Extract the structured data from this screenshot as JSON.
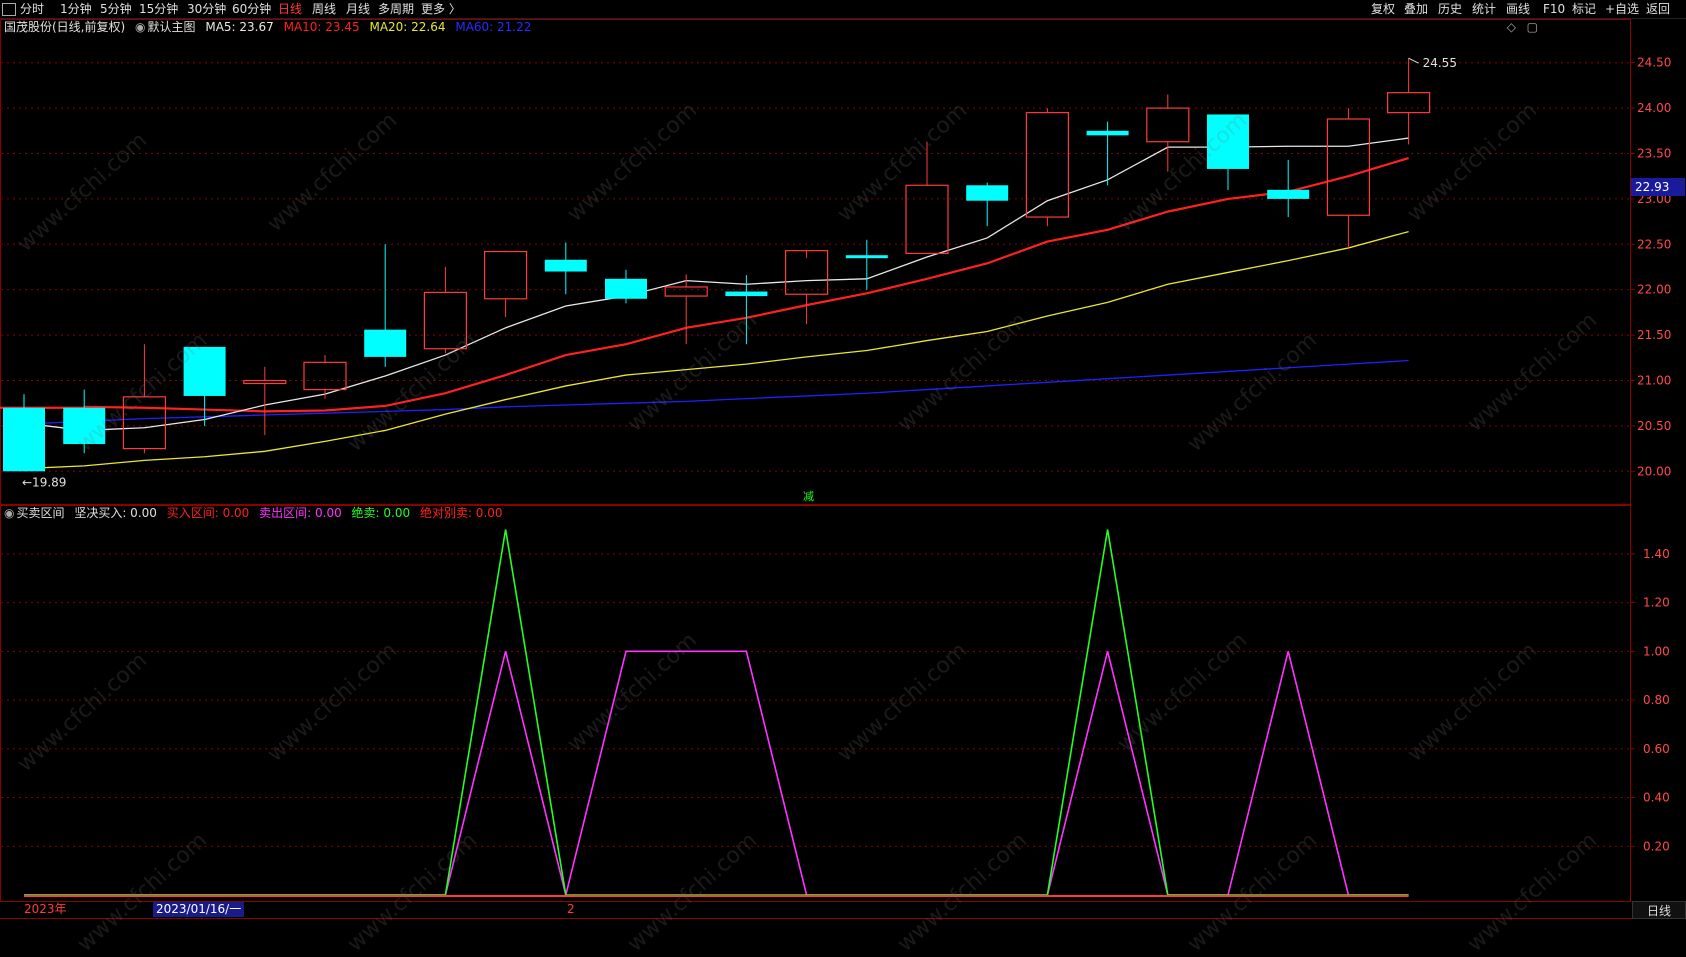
{
  "toolbar": {
    "left_items": [
      "分时",
      "1分钟",
      "5分钟",
      "15分钟",
      "30分钟",
      "60分钟",
      "日线",
      "周线",
      "月线",
      "多周期",
      "更多 〉"
    ],
    "active_item": "日线",
    "right_items": [
      "复权",
      "叠加",
      "历史",
      "统计",
      "画线",
      "F10",
      "标记",
      "+自选",
      "返回"
    ]
  },
  "main_info": {
    "stock": "国茂股份(日线,前复权)",
    "template": "默认主图",
    "ma5": "MA5: 23.67",
    "ma10": "MA10: 23.45",
    "ma20": "MA20: 22.64",
    "ma60": "MA60: 21.22"
  },
  "sub_info": {
    "name": "买卖区间",
    "firm_buy": "坚决买入: 0.00",
    "buy_zone": "买入区间: 0.00",
    "sell_zone": "卖出区间: 0.00",
    "sell": "绝卖: 0.00",
    "must_sell": "绝对别卖: 0.00"
  },
  "price_axis": [
    "24.50",
    "24.00",
    "23.50",
    "23.00",
    "22.50",
    "22.00",
    "21.50",
    "21.00",
    "20.50",
    "20.00"
  ],
  "current_price": "22.93",
  "high_label": "24.55",
  "low_label": "←19.89",
  "sub_axis": [
    "1.40",
    "1.20",
    "1.00",
    "0.80",
    "0.60",
    "0.40",
    "0.20"
  ],
  "date_labels": {
    "year": "2023年",
    "cursor_date": "2023/01/16/一",
    "month": "2"
  },
  "period_button": "日线",
  "watermark": "www.cfchi.com",
  "colors": {
    "up": "#ff3b3b",
    "down": "#00ffff",
    "ma5": "#e8e8e8",
    "ma10": "#ff2020",
    "ma20": "#e8e830",
    "ma60": "#2020ff",
    "green": "#22ff22",
    "magenta": "#ff33ff",
    "grid": "#8b0000"
  },
  "chart_data": {
    "type": "candlestick",
    "candles": [
      {
        "o": 20.7,
        "h": 20.85,
        "l": 20.0,
        "c": 20.0
      },
      {
        "o": 20.7,
        "h": 20.9,
        "l": 20.2,
        "c": 20.3
      },
      {
        "o": 20.25,
        "h": 21.4,
        "l": 20.2,
        "c": 20.82
      },
      {
        "o": 21.37,
        "h": 21.37,
        "l": 20.5,
        "c": 20.83
      },
      {
        "o": 21.0,
        "h": 21.15,
        "l": 20.4,
        "c": 21.0
      },
      {
        "o": 20.9,
        "h": 21.28,
        "l": 20.8,
        "c": 21.2
      },
      {
        "o": 21.56,
        "h": 22.5,
        "l": 21.15,
        "c": 21.26
      },
      {
        "o": 21.35,
        "h": 22.25,
        "l": 21.3,
        "c": 21.97
      },
      {
        "o": 21.9,
        "h": 22.43,
        "l": 21.7,
        "c": 22.42
      },
      {
        "o": 22.33,
        "h": 22.52,
        "l": 21.95,
        "c": 22.2
      },
      {
        "o": 22.12,
        "h": 22.22,
        "l": 21.85,
        "c": 21.9
      },
      {
        "o": 21.93,
        "h": 22.17,
        "l": 21.4,
        "c": 22.03
      },
      {
        "o": 21.98,
        "h": 22.16,
        "l": 21.4,
        "c": 21.93
      },
      {
        "o": 21.95,
        "h": 22.35,
        "l": 21.62,
        "c": 22.43
      },
      {
        "o": 22.38,
        "h": 22.55,
        "l": 22.0,
        "c": 22.37
      },
      {
        "o": 22.4,
        "h": 23.63,
        "l": 22.4,
        "c": 23.15
      },
      {
        "o": 23.15,
        "h": 23.18,
        "l": 22.7,
        "c": 22.98
      },
      {
        "o": 22.8,
        "h": 24.0,
        "l": 22.7,
        "c": 23.95
      },
      {
        "o": 23.75,
        "h": 23.85,
        "l": 23.15,
        "c": 23.7
      },
      {
        "o": 23.63,
        "h": 24.15,
        "l": 23.3,
        "c": 24.0
      },
      {
        "o": 23.93,
        "h": 23.93,
        "l": 23.1,
        "c": 23.33
      },
      {
        "o": 23.1,
        "h": 23.43,
        "l": 22.8,
        "c": 23.0
      },
      {
        "o": 22.82,
        "h": 24.0,
        "l": 22.45,
        "c": 23.88
      },
      {
        "o": 23.95,
        "h": 24.55,
        "l": 23.6,
        "c": 24.17
      }
    ],
    "ma5": [
      20.53,
      20.45,
      20.48,
      20.57,
      20.73,
      20.85,
      21.05,
      21.28,
      21.58,
      21.82,
      21.93,
      22.1,
      22.06,
      22.1,
      22.12,
      22.36,
      22.57,
      22.98,
      23.21,
      23.57,
      23.57,
      23.58,
      23.58,
      23.67
    ],
    "ma10": [
      20.71,
      20.7,
      20.68,
      20.66,
      20.67,
      20.72,
      20.86,
      21.06,
      21.28,
      21.4,
      21.58,
      21.69,
      21.83,
      21.96,
      22.12,
      22.29,
      22.53,
      22.66,
      22.86,
      23.0,
      23.08,
      23.25,
      23.45
    ],
    "ma20": [
      20.03,
      20.06,
      20.12,
      20.16,
      20.22,
      20.33,
      20.45,
      20.63,
      20.79,
      20.94,
      21.06,
      21.12,
      21.18,
      21.26,
      21.33,
      21.44,
      21.54,
      21.71,
      21.86,
      22.06,
      22.19,
      22.32,
      22.46,
      22.64
    ],
    "ma60": [
      20.52,
      20.55,
      20.58,
      20.6,
      20.62,
      20.64,
      20.66,
      20.68,
      20.71,
      20.73,
      20.75,
      20.77,
      20.8,
      20.83,
      20.86,
      20.9,
      20.94,
      20.98,
      21.02,
      21.06,
      21.1,
      21.14,
      21.18,
      21.22
    ],
    "ind_green": [
      0,
      0,
      0,
      0,
      0,
      0,
      0,
      0,
      1.5,
      0,
      0,
      0,
      0,
      0,
      0,
      0,
      0,
      0,
      1.5,
      0,
      0,
      0,
      0,
      0
    ],
    "ind_magenta": [
      0,
      0,
      0,
      0,
      0,
      0,
      0,
      0,
      1.0,
      0,
      1.0,
      1.0,
      1.0,
      0,
      0,
      0,
      0,
      0,
      1.0,
      0,
      0,
      1.0,
      0,
      0
    ],
    "price_range": [
      19.75,
      24.75
    ],
    "ind_range": [
      0,
      1.58
    ]
  }
}
